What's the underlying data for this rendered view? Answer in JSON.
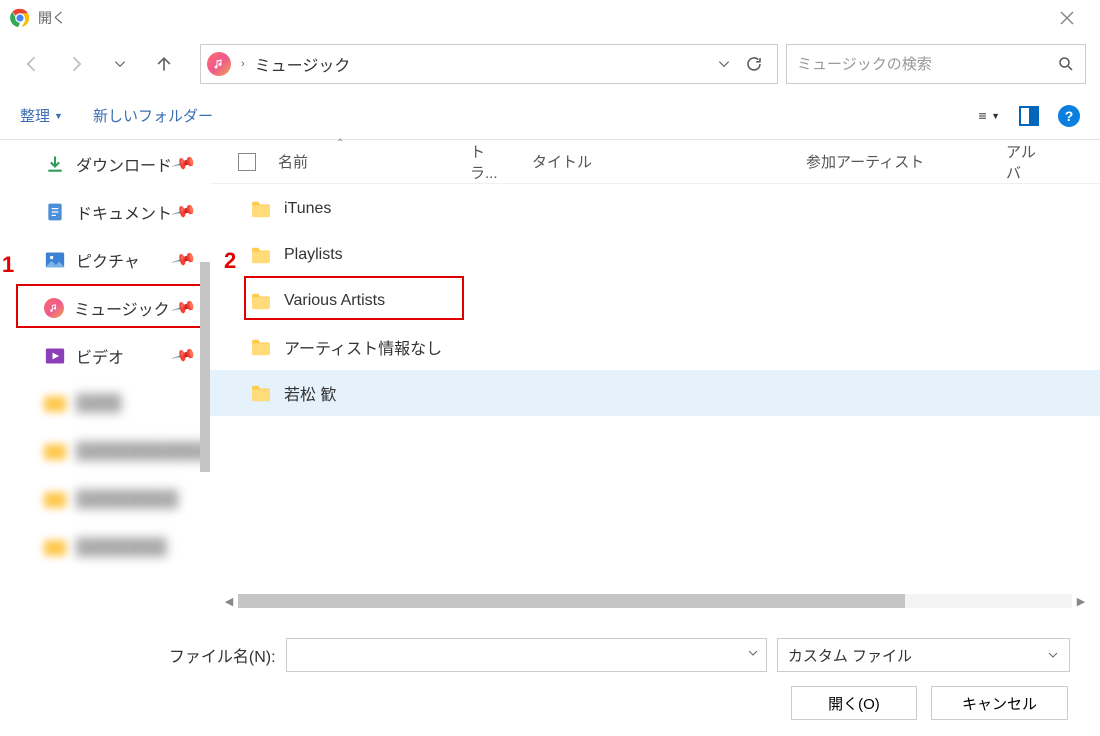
{
  "window": {
    "title": "開く"
  },
  "breadcrumb": {
    "location": "ミュージック"
  },
  "search": {
    "placeholder": "ミュージックの検索"
  },
  "toolbar": {
    "organize": "整理",
    "new_folder": "新しいフォルダー"
  },
  "columns": {
    "name": "名前",
    "track": "トラ...",
    "title": "タイトル",
    "artist": "参加アーティスト",
    "album": "アルバ"
  },
  "sidebar": {
    "items": [
      {
        "label": "ダウンロード",
        "icon": "download"
      },
      {
        "label": "ドキュメント",
        "icon": "document"
      },
      {
        "label": "ピクチャ",
        "icon": "picture"
      },
      {
        "label": "ミュージック",
        "icon": "music"
      },
      {
        "label": "ビデオ",
        "icon": "video"
      }
    ]
  },
  "files": [
    {
      "name": "iTunes"
    },
    {
      "name": "Playlists"
    },
    {
      "name": "Various Artists"
    },
    {
      "name": "アーティスト情報なし"
    },
    {
      "name": "若松 歓"
    }
  ],
  "bottom": {
    "filename_label": "ファイル名(N):",
    "filter": "カスタム ファイル",
    "open": "開く(O)",
    "cancel": "キャンセル"
  },
  "annotations": {
    "one": "1",
    "two": "2"
  }
}
